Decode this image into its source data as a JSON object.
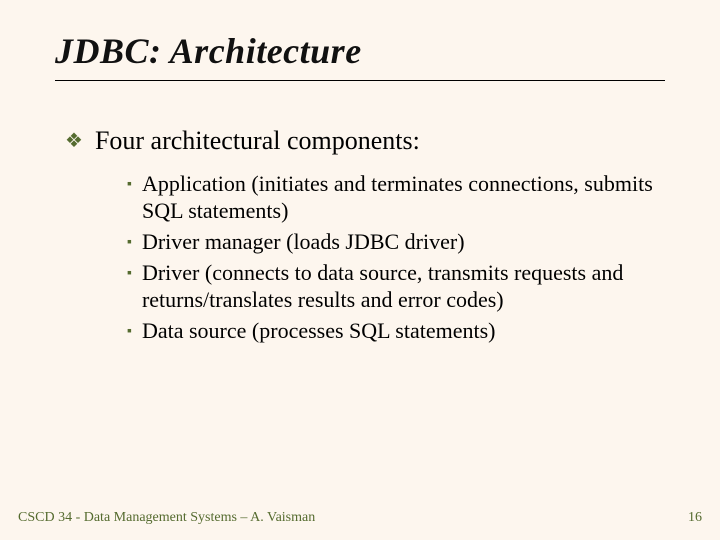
{
  "title": "JDBC: Architecture",
  "level1": {
    "text": "Four architectural components:"
  },
  "level2": [
    {
      "text": "Application (initiates and terminates connections, submits SQL statements)"
    },
    {
      "text": "Driver manager (loads JDBC driver)"
    },
    {
      "text": "Driver (connects to data source, transmits requests and returns/translates results and error codes)"
    },
    {
      "text": "Data source (processes SQL statements)"
    }
  ],
  "footer": {
    "left": "CSCD 34 - Data Management Systems – A. Vaisman",
    "right": "16"
  }
}
